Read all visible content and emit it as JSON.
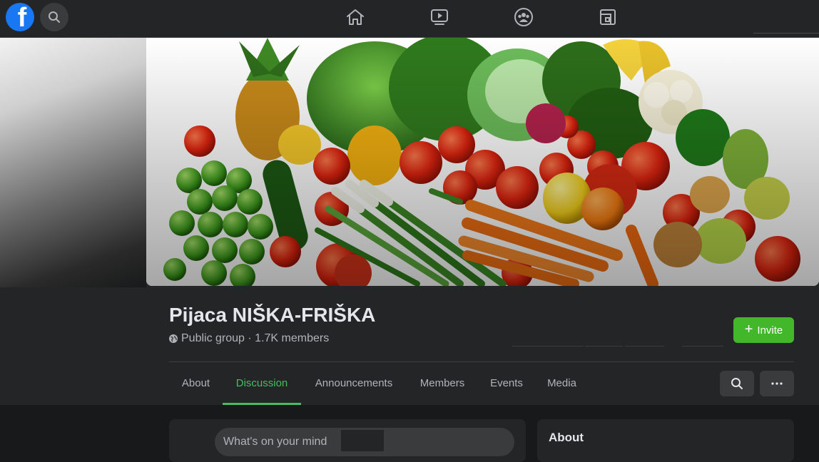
{
  "topbar": {
    "logo_letter": "f",
    "icons": [
      "facebook-logo-icon",
      "search-icon",
      "home-icon",
      "watch-video-icon",
      "groups-icon",
      "gaming-icon"
    ]
  },
  "group": {
    "title": "Pijaca NIŠKA-FRIŠKA",
    "meta": "Public group · 1.7K members",
    "invite_label": "Invite"
  },
  "tabs": [
    {
      "label": "About",
      "active": false
    },
    {
      "label": "Discussion",
      "active": true
    },
    {
      "label": "Announcements",
      "active": false
    },
    {
      "label": "Members",
      "active": false
    },
    {
      "label": "Events",
      "active": false
    },
    {
      "label": "Media",
      "active": false
    }
  ],
  "composer": {
    "placeholder": "What's on your mind"
  },
  "about_card": {
    "title": "About"
  },
  "colors": {
    "background": "#18191a",
    "surface": "#242526",
    "accent_green": "#45bd62",
    "invite_green": "#42b72a",
    "facebook_blue": "#1877f2"
  }
}
